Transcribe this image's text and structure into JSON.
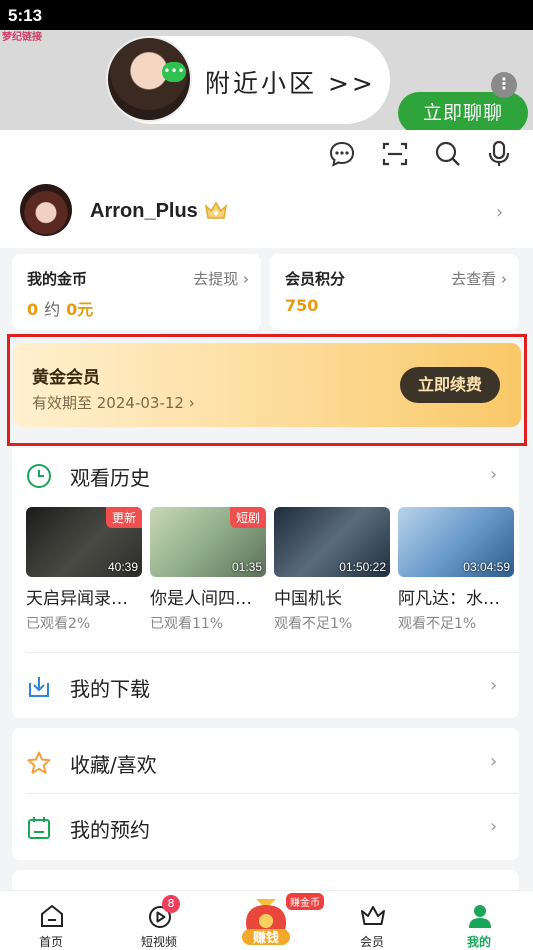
{
  "status_bar": {
    "time": "5:13"
  },
  "ad": {
    "logo_text": "梦纪链接",
    "headline": "附近小区 >>",
    "cta": "立即聊聊",
    "more": "⋮"
  },
  "profile": {
    "username": "Arron_Plus"
  },
  "coins": {
    "title": "我的金币",
    "link": "去提现 ›",
    "amount": "0",
    "approx": "约",
    "cash": "0元"
  },
  "points": {
    "title": "会员积分",
    "link": "去查看 ›",
    "value": "750"
  },
  "membership": {
    "title": "黄金会员",
    "expiry": "有效期至 2024-03-12 ›",
    "renew": "立即续费"
  },
  "history": {
    "title": "观看历史",
    "items": [
      {
        "title": "天启异闻录…",
        "progress": "已观看2%",
        "duration": "40:39",
        "tag": "更新"
      },
      {
        "title": "你是人间四…",
        "progress": "已观看11%",
        "duration": "01:35",
        "tag": "短剧"
      },
      {
        "title": "中国机长",
        "progress": "观看不足1%",
        "duration": "01:50:22",
        "tag": ""
      },
      {
        "title": "阿凡达：水…",
        "progress": "观看不足1%",
        "duration": "03:04:59",
        "tag": ""
      }
    ]
  },
  "downloads": {
    "title": "我的下载"
  },
  "favorites": {
    "title": "收藏/喜欢"
  },
  "reservations": {
    "title": "我的预约"
  },
  "tabs": {
    "home": "首页",
    "shorts": "短视频",
    "shorts_badge": "8",
    "earn": "赚钱",
    "earn_tag": "赚金币",
    "vip": "会员",
    "me": "我的"
  },
  "colors": {
    "accent_green": "#2ea43a",
    "coin_orange": "#e89b0c",
    "tab_active": "#19a55a"
  }
}
